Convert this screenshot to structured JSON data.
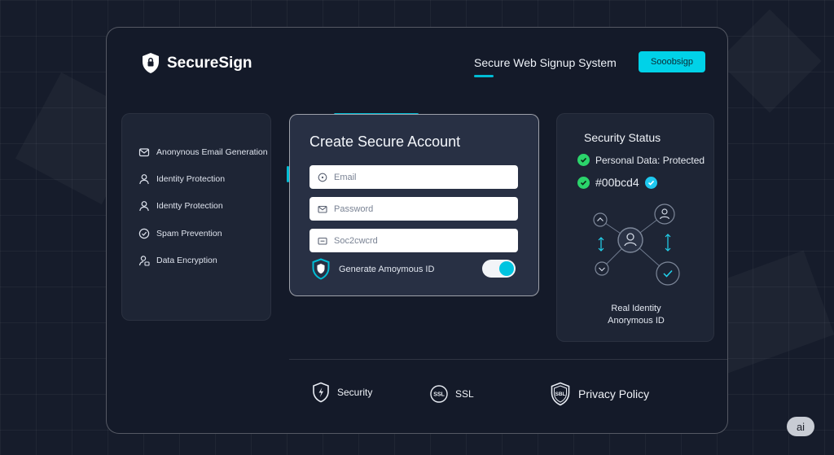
{
  "app": {
    "name": "SecureSign"
  },
  "header": {
    "title": "Secure Web Signup System",
    "button_label": "Sooobsigp"
  },
  "features": {
    "items": [
      {
        "label": "Anonynous Email Generation",
        "icon": "email-icon"
      },
      {
        "label": "Identity Protection",
        "icon": "user-icon"
      },
      {
        "label": "Identty Protection",
        "icon": "user-icon"
      },
      {
        "label": "Spam Prevention",
        "icon": "spam-icon"
      },
      {
        "label": "Data Encryption",
        "icon": "lock-user-icon"
      }
    ]
  },
  "form": {
    "title": "Create Secure Account",
    "email_placeholder": "Email",
    "password_placeholder": "Password",
    "third_placeholder": "Soc2cwcrd",
    "generate_label": "Generate Amoymous ID",
    "toggle_on": true
  },
  "status": {
    "title": "Security Status",
    "item1": "Personal Data: Protected",
    "item2": "#00bcd4",
    "diagram_label_1": "Real Identity",
    "diagram_label_2": "Anorymous ID"
  },
  "footer": {
    "security_label": "Security",
    "ssl_label": "SSL",
    "ssl_icon_text": "SSL",
    "privacy_label": "Privacy Policy",
    "privacy_icon_text": "SBL"
  },
  "badge": {
    "label": "ai"
  },
  "colors": {
    "accent": "#00bcd4",
    "success": "#2bd46b",
    "background": "#161c2b"
  }
}
